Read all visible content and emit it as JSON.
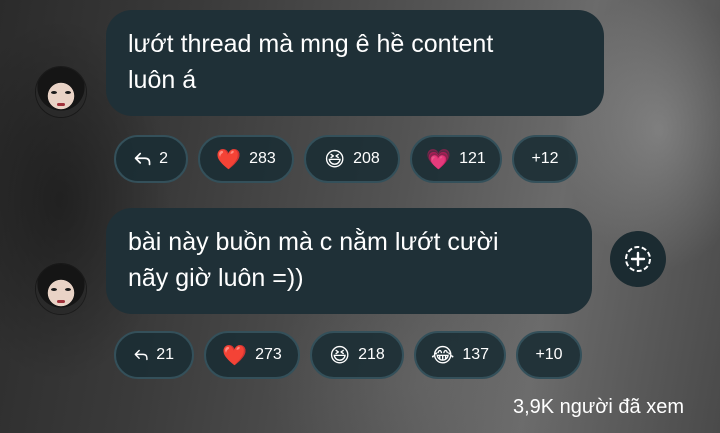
{
  "comments": [
    {
      "text_line1": "lướt thread mà mng ê hề content",
      "text_line2": "luôn á",
      "reply_count": "2",
      "reactions": [
        {
          "emoji": "❤️",
          "icon": "red-heart-icon",
          "count": "283"
        },
        {
          "emoji": "😆",
          "icon": "grinning-squinting-face-icon",
          "count": "208"
        },
        {
          "emoji": "💗",
          "icon": "pink-heart-icon",
          "count": "121"
        }
      ],
      "more": "+12"
    },
    {
      "text_line1": "bài này buồn mà c nằm lướt cười",
      "text_line2": "nãy giờ luôn =))",
      "reply_count": "21",
      "reactions": [
        {
          "emoji": "❤️",
          "icon": "red-heart-icon",
          "count": "273"
        },
        {
          "emoji": "😆",
          "icon": "grinning-squinting-face-icon",
          "count": "218"
        },
        {
          "emoji": "😂",
          "icon": "tears-of-joy-face-icon",
          "count": "137"
        }
      ],
      "more": "+10"
    }
  ],
  "views_text": "3,9K người đã xem",
  "colors": {
    "bubble": "#1f3037",
    "chip_border": "#34505a",
    "text": "#ffffff"
  }
}
